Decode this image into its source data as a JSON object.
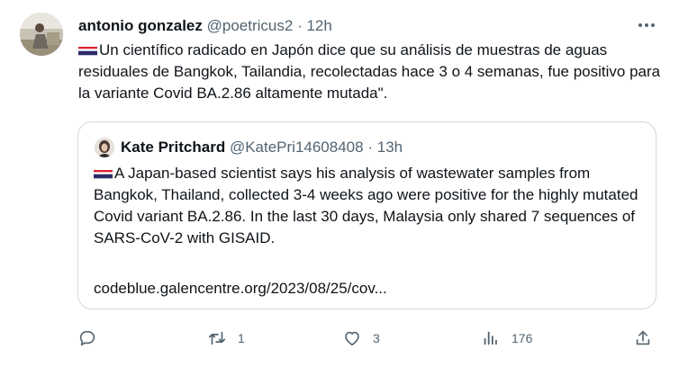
{
  "tweet": {
    "author_name": "antonio gonzalez",
    "author_handle": "@poetricus2",
    "separator": "·",
    "time": "12h",
    "text": "Un científico radicado en Japón dice que su análisis de muestras de aguas residuales de Bangkok, Tailandia, recolectadas hace 3 o 4 semanas, fue positivo para la variante Covid BA.2.86 altamente mutada\".",
    "flag_icon": "thailand-flag-icon"
  },
  "quoted": {
    "author_name": "Kate Pritchard",
    "author_handle": "@KatePri14608408",
    "separator": "·",
    "time": "13h",
    "text": "A Japan-based scientist says his analysis of wastewater samples from Bangkok, Thailand, collected 3-4 weeks ago were positive for the highly mutated Covid variant BA.2.86. In the last 30 days, Malaysia only shared 7 sequences of SARS-CoV-2 with GISAID.",
    "link": "codeblue.galencentre.org/2023/08/25/cov...",
    "flag_icon": "thailand-flag-icon"
  },
  "actions": {
    "reply_count": "",
    "retweet_count": "1",
    "like_count": "3",
    "views_count": "176"
  },
  "colors": {
    "text": "#0f1419",
    "secondary": "#536471",
    "border": "#cfd9de",
    "flag_red": "#d9232f",
    "flag_white": "#ffffff",
    "flag_blue": "#2d2a6b"
  }
}
